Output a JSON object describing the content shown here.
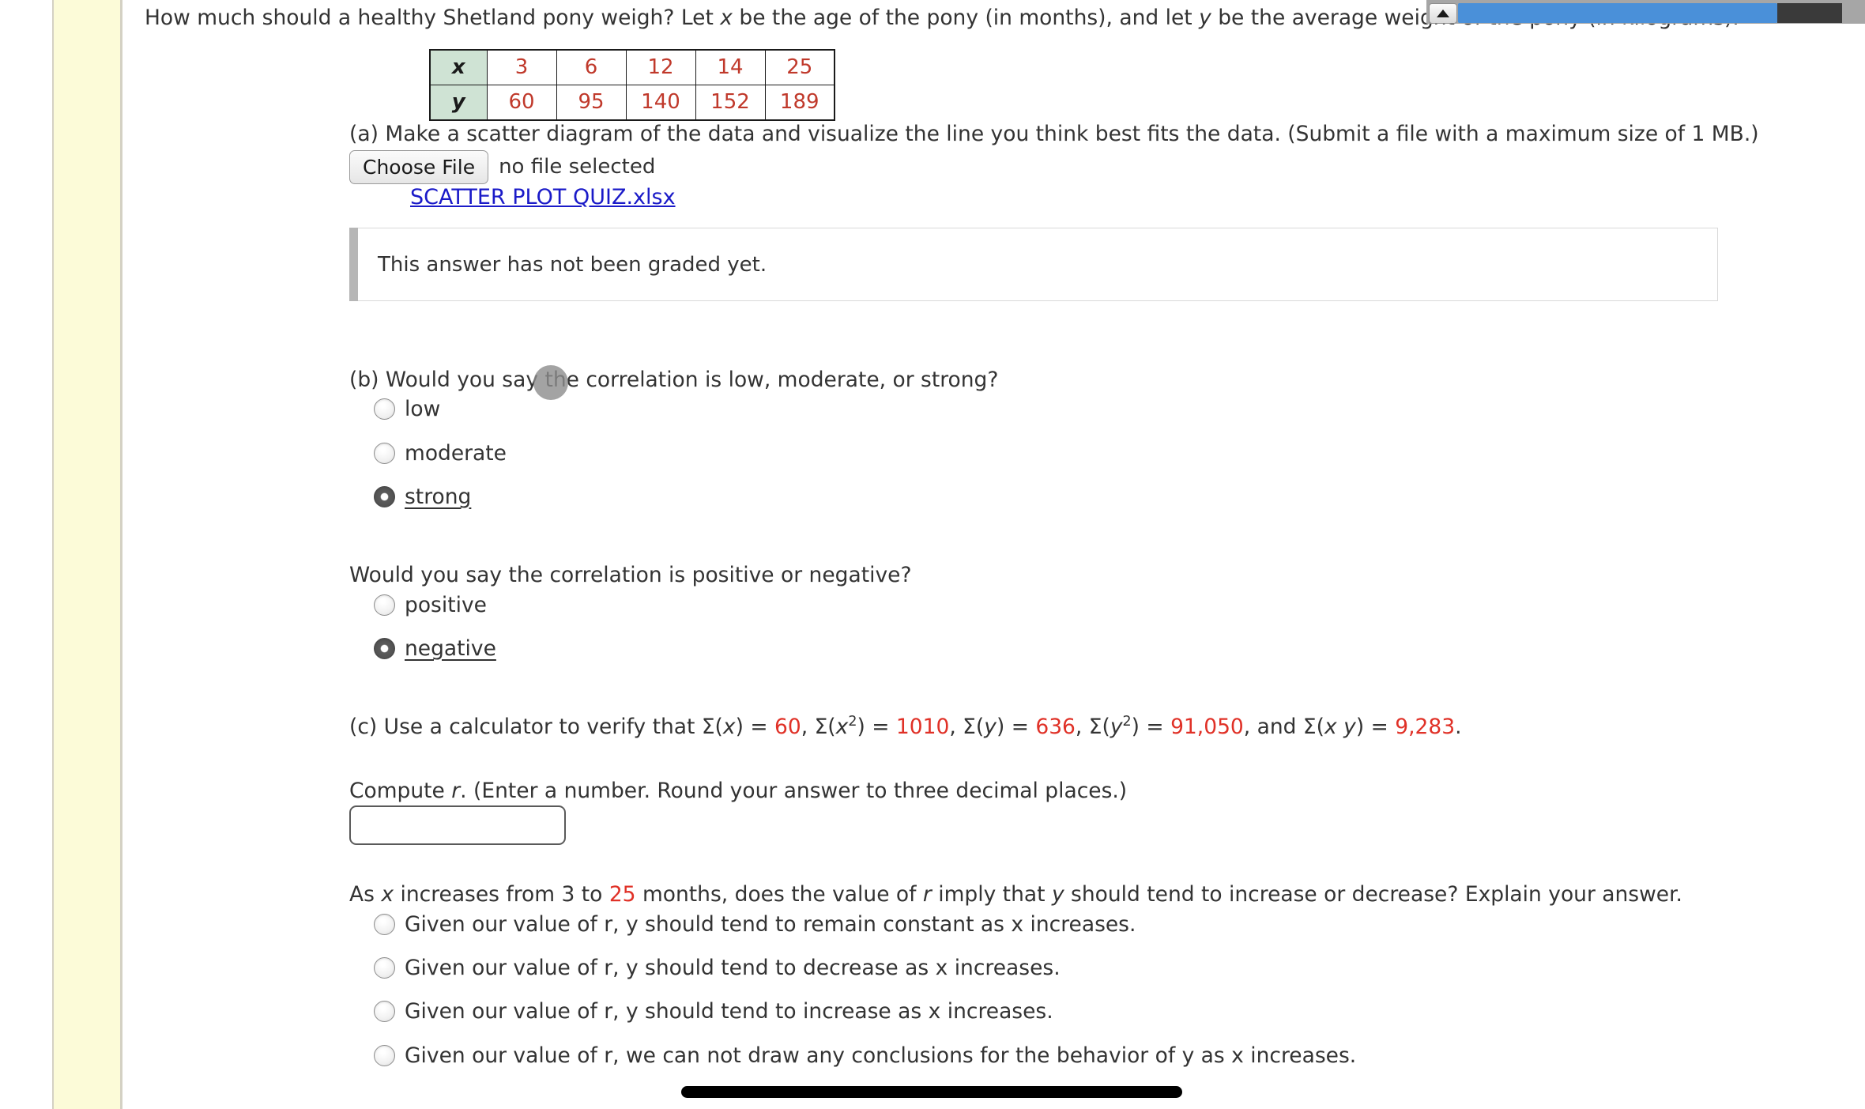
{
  "question": {
    "intro": "How much should a healthy Shetland pony weigh? Let x be the age of the pony (in months), and let y be the average weight of the pony (in kilograms)."
  },
  "data_table": {
    "row_x_label": "x",
    "row_y_label": "y",
    "x": [
      "3",
      "6",
      "12",
      "14",
      "25"
    ],
    "y": [
      "60",
      "95",
      "140",
      "152",
      "189"
    ]
  },
  "part_a": {
    "prompt": "(a) Make a scatter diagram of the data and visualize the line you think best fits the data. (Submit a file with a maximum size of 1 MB.)",
    "choose_file_label": "Choose File",
    "file_status": "no file selected",
    "uploaded_file_name": "SCATTER PLOT QUIZ.xlsx",
    "graded_notice": "This answer has not been graded yet."
  },
  "part_b": {
    "prompt": "(b) Would you say the correlation is low, moderate, or strong?",
    "options": [
      {
        "label": "low",
        "selected": false
      },
      {
        "label": "moderate",
        "selected": false
      },
      {
        "label": "strong",
        "selected": true
      }
    ]
  },
  "part_b_sign": {
    "prompt": "Would you say the correlation is positive or negative?",
    "options": [
      {
        "label": "positive",
        "selected": false
      },
      {
        "label": "negative",
        "selected": true
      }
    ]
  },
  "part_c": {
    "prefix": "(c) Use a calculator to verify that ",
    "sum_x_label": "Σ(x) = ",
    "sum_x_value": "60",
    "sum_x2_label_a": ", Σ(x",
    "sum_x2_label_b": ") = ",
    "sum_x2_value": "1010",
    "sum_y_label": ", Σ(y) = ",
    "sum_y_value": "636",
    "sum_y2_label_a": ", Σ(y",
    "sum_y2_label_b": ") = ",
    "sum_y2_value": "91,050",
    "sum_xy_label": ", and Σ(x y) = ",
    "sum_xy_value": "9,283",
    "suffix": ".",
    "compute_prompt": "Compute r. (Enter a number. Round your answer to three decimal places.)",
    "r_input_value": "",
    "r_input_placeholder": ""
  },
  "final_question": {
    "prefix": "As x increases from 3 to ",
    "highlight": "25",
    "suffix": " months, does the value of r imply that y should tend to increase or decrease? Explain your answer.",
    "options": [
      {
        "label": "Given our value of r, y should tend to remain constant as x increases.",
        "selected": false
      },
      {
        "label": "Given our value of r, y should tend to decrease as x increases.",
        "selected": false
      },
      {
        "label": "Given our value of r, y should tend to increase as x increases.",
        "selected": false
      },
      {
        "label": "Given our value of r, we can not draw any conclusions for the behavior of y as x increases.",
        "selected": false
      }
    ]
  },
  "chrome": {
    "scrollbar_thumb_color": "#4a90d9",
    "sidebar_color": "#fcfbd8",
    "accent_red": "#e03127",
    "link_color": "#1a1ac8"
  }
}
